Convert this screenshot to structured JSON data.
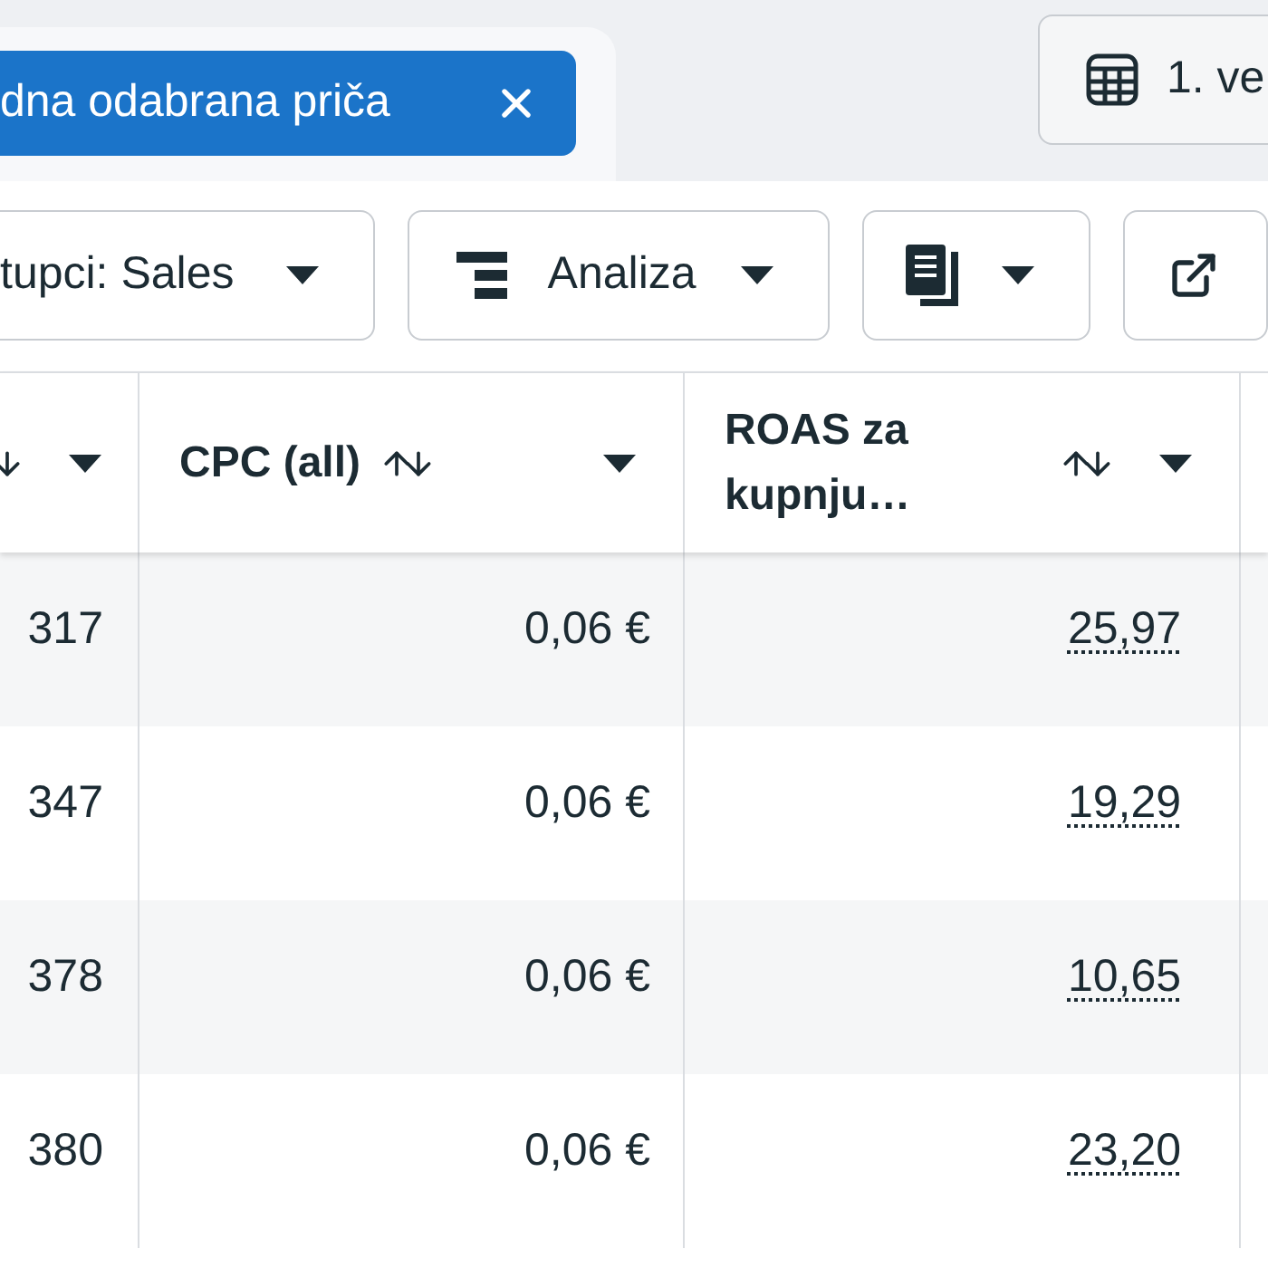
{
  "filter_chip": {
    "label": "dna odabrana priča"
  },
  "date_button": {
    "label": "1. ve"
  },
  "toolbar": {
    "columns_button": {
      "label": "tupci: Sales"
    },
    "breakdown_button": {
      "label": "Analiza"
    }
  },
  "table": {
    "columns": [
      {},
      {
        "label": "CPC (all)"
      },
      {
        "label": "ROAS za kupnju…"
      }
    ],
    "rows": [
      {
        "cells": [
          "317",
          "0,06 €",
          "25,97"
        ]
      },
      {
        "cells": [
          "347",
          "0,06 €",
          "19,29"
        ]
      },
      {
        "cells": [
          "378",
          "0,06 €",
          "10,65"
        ]
      },
      {
        "cells": [
          "380",
          "0,06 €",
          "23,20"
        ]
      }
    ]
  }
}
